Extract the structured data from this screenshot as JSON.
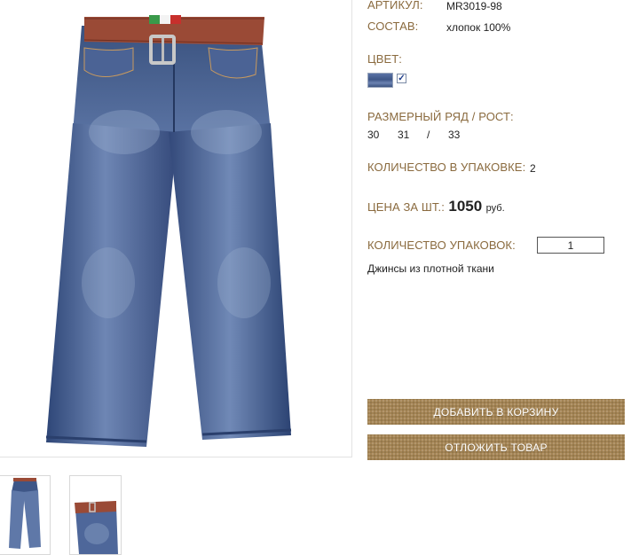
{
  "product": {
    "article_label": "АРТИКУЛ:",
    "article_value": "MR3019-98",
    "composition_label": "СОСТАВ:",
    "composition_value": "хлопок 100%",
    "color_label": "ЦВЕТ:",
    "size_label": "РАЗМЕРНЫЙ РЯД / РОСТ:",
    "sizes": [
      "30",
      "31",
      "/",
      "33"
    ],
    "pack_qty_label": "КОЛИЧЕСТВО В УПАКОВКЕ:",
    "pack_qty_value": "2",
    "price_label": "ЦЕНА ЗА ШТ.:",
    "price_value": "1050",
    "price_currency": "руб.",
    "packs_label": "КОЛИЧЕСТВО УПАКОВОК:",
    "packs_value": "1",
    "description": "Джинсы из плотной ткани"
  },
  "actions": {
    "add_to_cart": "ДОБАВИТЬ В КОРЗИНУ",
    "postpone": "ОТЛОЖИТЬ ТОВАР"
  },
  "colors": {
    "label": "#8a6a3e",
    "button": "#a48454",
    "denim": "#3e5687"
  },
  "icons": {
    "color_checkbox": "checkmark-icon"
  }
}
